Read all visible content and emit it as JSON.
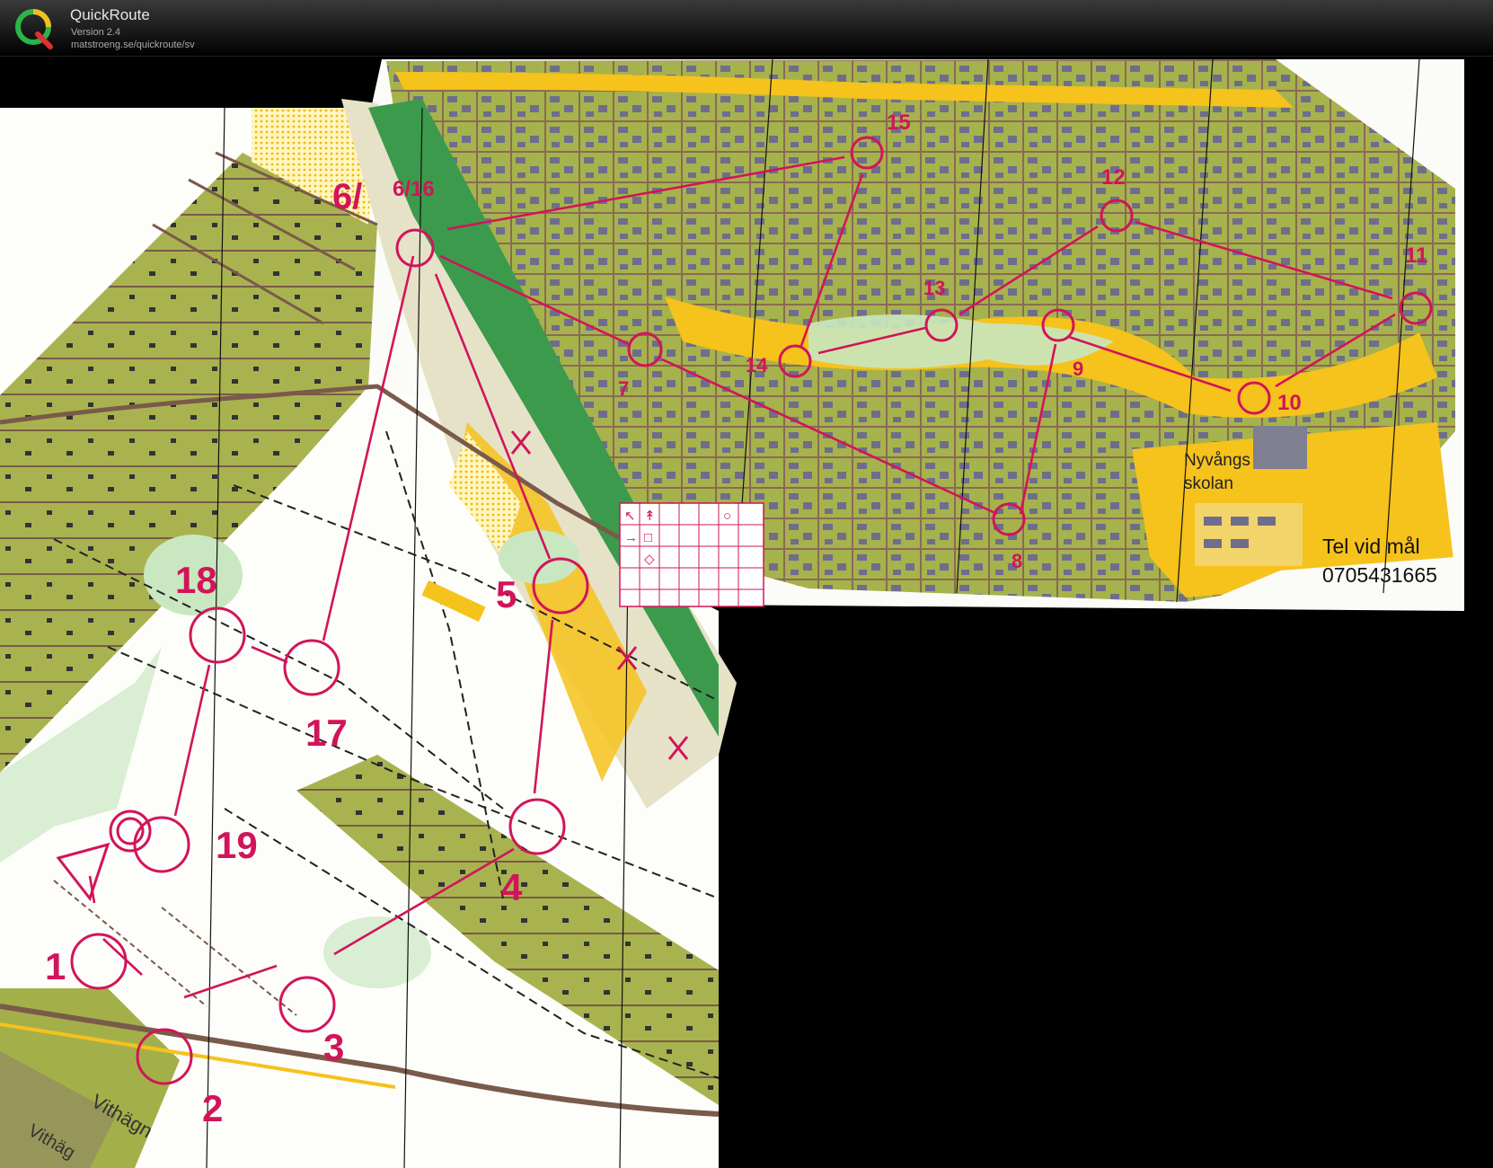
{
  "app": {
    "title": "QuickRoute",
    "version": "Version 2.4",
    "url": "matstroeng.se/quickroute/sv",
    "logo_letter": "Q"
  },
  "map": {
    "controls": [
      "1",
      "2",
      "3",
      "4",
      "5",
      "6/",
      "6/16",
      "7",
      "8",
      "9",
      "10",
      "11",
      "12",
      "13",
      "14",
      "15",
      "17",
      "18",
      "19"
    ],
    "school_label_line1": "Nyvångs",
    "school_label_line2": "skolan",
    "road_label_1": "Vithägn",
    "road_label_2": "Vithäg",
    "info_line1": "Tel vid mål",
    "info_line2": "0705431665",
    "legend_symbols": [
      "↖",
      "↟",
      "→",
      "□",
      "◇",
      "○"
    ]
  },
  "colors": {
    "course": "#d2145a",
    "forest_green": "#a3b04a",
    "open_yellow": "#f6c21c",
    "green_light": "#c9e7c0",
    "paper": "#fdfdfa",
    "road": "#8a6a55",
    "house": "#6e6e8c"
  }
}
